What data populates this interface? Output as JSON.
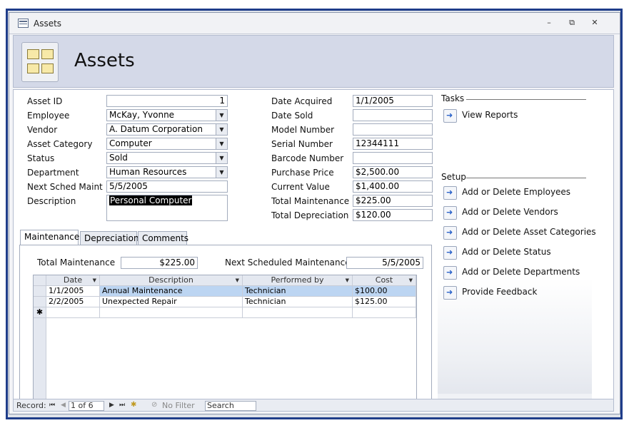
{
  "window": {
    "title": "Assets"
  },
  "header": {
    "title": "Assets"
  },
  "left_fields": [
    {
      "label": "Asset ID",
      "value": "1",
      "kind": "number"
    },
    {
      "label": "Employee",
      "value": "McKay, Yvonne",
      "kind": "combo"
    },
    {
      "label": "Vendor",
      "value": "A. Datum Corporation",
      "kind": "combo"
    },
    {
      "label": "Asset Category",
      "value": "Computer",
      "kind": "combo"
    },
    {
      "label": "Status",
      "value": "Sold",
      "kind": "combo"
    },
    {
      "label": "Department",
      "value": "Human Resources",
      "kind": "combo"
    },
    {
      "label": "Next Sched Maint",
      "value": "5/5/2005",
      "kind": "text"
    },
    {
      "label": "Description",
      "value": "Personal Computer",
      "kind": "memo"
    }
  ],
  "right_fields": [
    {
      "label": "Date Acquired",
      "value": "1/1/2005"
    },
    {
      "label": "Date Sold",
      "value": ""
    },
    {
      "label": "Model Number",
      "value": ""
    },
    {
      "label": "Serial Number",
      "value": "12344111"
    },
    {
      "label": "Barcode Number",
      "value": ""
    },
    {
      "label": "Purchase Price",
      "value": "$2,500.00"
    },
    {
      "label": "Current Value",
      "value": "$1,400.00"
    },
    {
      "label": "Total Maintenance",
      "value": "$225.00"
    },
    {
      "label": "Total Depreciation",
      "value": "$120.00"
    }
  ],
  "tabs": [
    "Maintenance",
    "Depreciation",
    "Comments"
  ],
  "maintenance": {
    "total_label": "Total Maintenance",
    "total_value": "$225.00",
    "next_label": "Next Scheduled Maintenance",
    "next_value": "5/5/2005",
    "columns": [
      "Date",
      "Description",
      "Performed by",
      "Cost"
    ],
    "rows": [
      [
        "1/1/2005",
        "Annual Maintenance",
        "Technician",
        "$100.00"
      ],
      [
        "2/2/2005",
        "Unexpected Repair",
        "Technician",
        "$125.00"
      ]
    ],
    "new_row_marker": "✱"
  },
  "tasks": {
    "title": "Tasks",
    "items": [
      "View Reports"
    ]
  },
  "setup": {
    "title": "Setup",
    "items": [
      "Add or Delete Employees",
      "Add or Delete Vendors",
      "Add or Delete Asset Categories",
      "Add or Delete Status",
      "Add or Delete Departments"
    ]
  },
  "feedback": {
    "label": "Provide Feedback"
  },
  "navbar": {
    "record_label": "Record:",
    "position": "1 of 6",
    "filter": "No Filter",
    "search": "Search"
  }
}
